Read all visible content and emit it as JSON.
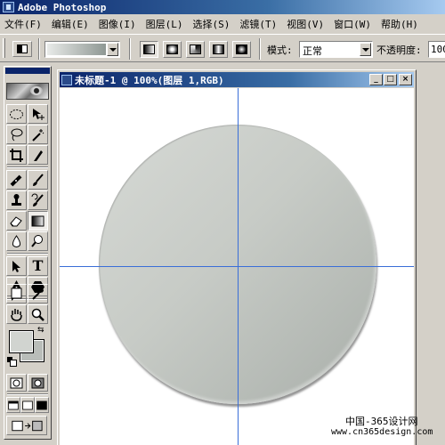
{
  "app": {
    "title": "Adobe Photoshop"
  },
  "menu": [
    "文件(F)",
    "编辑(E)",
    "图像(I)",
    "图层(L)",
    "选择(S)",
    "滤镜(T)",
    "视图(V)",
    "窗口(W)",
    "帮助(H)"
  ],
  "options": {
    "mode_label": "模式:",
    "mode_value": "正常",
    "opacity_label": "不透明度:",
    "opacity_value": "100",
    "gradient_colors": [
      "#e8eae8",
      "#8f9894"
    ],
    "gradient_types": [
      "linear-gradient-icon",
      "radial-gradient-icon",
      "angle-gradient-icon",
      "reflected-gradient-icon",
      "diamond-gradient-icon"
    ]
  },
  "toolbox": {
    "foreground_color": "#d1d4d0",
    "background_color": "#b9bdb9",
    "type_tool_glyph": "T"
  },
  "document": {
    "title": "未标题-1 @ 100%(图层 1,RGB)",
    "min_button": "_",
    "max_button": "□",
    "close_button": "×",
    "disc_color": "#c4c8c3",
    "guide_color": "#3a6ed8"
  },
  "watermark": {
    "site_cn": "中国-365设计网",
    "url": "www.cn365design.com"
  }
}
